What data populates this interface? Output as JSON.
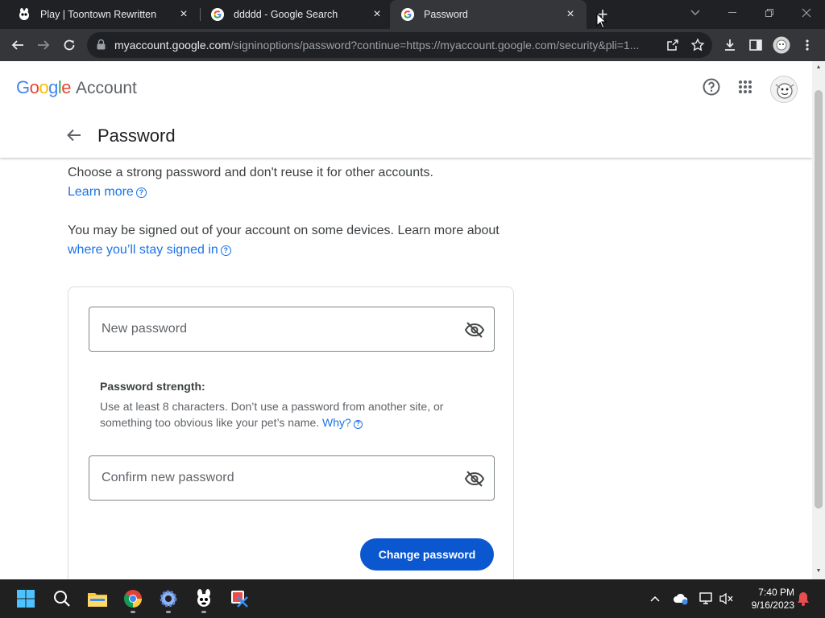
{
  "browser": {
    "tabs": [
      {
        "title": "Play | Toontown Rewritten",
        "icon": "toontown-icon",
        "active": false
      },
      {
        "title": "ddddd - Google Search",
        "icon": "google-g-icon",
        "active": false
      },
      {
        "title": "Password",
        "icon": "google-g-icon",
        "active": true
      }
    ],
    "url_host": "myaccount.google.com",
    "url_path": "/signinoptions/password?continue=https://myaccount.google.com/security&pli=1..."
  },
  "header": {
    "logo_google": "Google",
    "logo_account": "Account",
    "page_title": "Password"
  },
  "intro": {
    "line1": "Choose a strong password and don't reuse it for other accounts.",
    "learn_more": "Learn more",
    "line2": "You may be signed out of your account on some devices. Learn more about",
    "stay_signed_in": "where you’ll stay signed in"
  },
  "form": {
    "new_password_placeholder": "New password",
    "strength_title": "Password strength:",
    "strength_text": "Use at least 8 characters. Don’t use a password from another site, or something too obvious like your pet’s name.",
    "why": "Why?",
    "confirm_placeholder": "Confirm new password",
    "submit_label": "Change password"
  },
  "taskbar": {
    "time": "7:40 PM",
    "date": "9/16/2023"
  },
  "colors": {
    "primary_button": "#0b57d0",
    "link": "#1a73e8",
    "google_blue": "#4285f4",
    "google_red": "#ea4335",
    "google_yellow": "#fbbc05",
    "google_green": "#34a853"
  }
}
